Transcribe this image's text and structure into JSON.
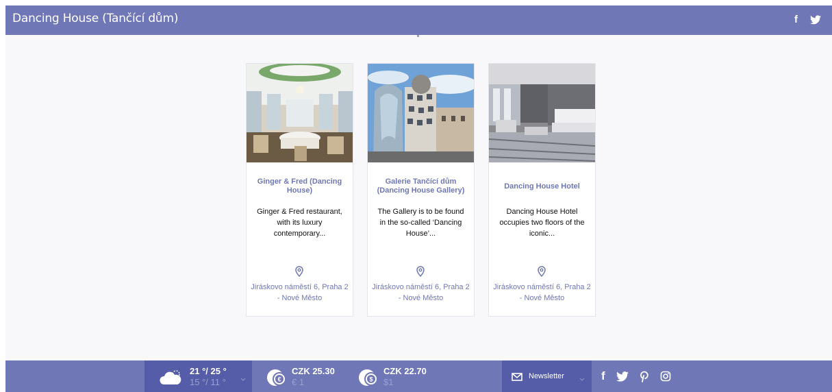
{
  "header": {
    "title": "Dancing House (Tančící dům)",
    "social": [
      {
        "icon": "facebook-icon"
      },
      {
        "icon": "twitter-icon"
      }
    ]
  },
  "cards": [
    {
      "name": "Ginger & Fred (Dancing House)",
      "description": "Ginger & Fred restaurant, with its luxury contemporary...",
      "address": "Jiráskovo náměstí 6, Praha 2 - Nové Město",
      "image": "restaurant-interior-photo"
    },
    {
      "name": "Galerie Tančící dům (Dancing House Gallery)",
      "description": "The Gallery is to be found in the so-called ‘Dancing House’...",
      "address": "Jiráskovo náměstí 6, Praha 2 - Nové Město",
      "image": "dancing-house-building-photo"
    },
    {
      "name": "Dancing House Hotel",
      "description": "Dancing House Hotel occupies two floors of the iconic...",
      "address": "Jiráskovo náměstí 6, Praha 2 - Nové Město",
      "image": "hotel-room-photo"
    }
  ],
  "footer": {
    "weather": {
      "high": "21 °/ 25 °",
      "low": "15 °/ 11 °",
      "icon": "partly-cloudy-icon"
    },
    "currency_eur": {
      "rate": "CZK 25.30",
      "base": "€ 1",
      "icon": "euro-coin-icon"
    },
    "currency_usd": {
      "rate": "CZK 22.70",
      "base": "$1",
      "icon": "dollar-coin-icon"
    },
    "newsletter": {
      "label": "Newsletter",
      "icon": "envelope-icon"
    },
    "social": [
      {
        "icon": "facebook-icon"
      },
      {
        "icon": "twitter-icon"
      },
      {
        "icon": "pinterest-icon"
      },
      {
        "icon": "instagram-icon"
      }
    ]
  },
  "colors": {
    "brand": "#6f77b6",
    "brand_dark": "#555da8",
    "background": "#f8f8fb",
    "muted_text": "#9aa0d0"
  }
}
